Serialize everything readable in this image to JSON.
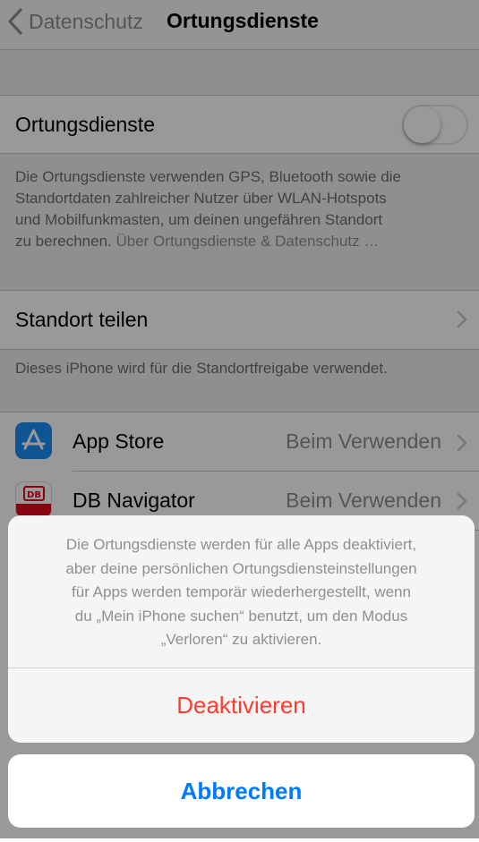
{
  "nav": {
    "back_label": "Datenschutz",
    "title": "Ortungsdienste"
  },
  "location_services": {
    "label": "Ortungsdienste",
    "enabled": false
  },
  "description": {
    "lines": [
      "Die Ortungsdienste verwenden GPS, Bluetooth sowie die",
      "Standortdaten zahlreicher Nutzer über WLAN-Hotspots",
      "und Mobilfunkmasten, um deinen ungefähren Standort",
      "zu berechnen."
    ],
    "link": "Über Ortungsdienste & Datenschutz …"
  },
  "share_location": {
    "label": "Standort teilen",
    "footer": "Dieses iPhone wird für die Standortfreigabe verwendet."
  },
  "apps": [
    {
      "name": "App Store",
      "value": "Beim Verwenden",
      "icon": "app-store-icon"
    },
    {
      "name": "DB Navigator",
      "value": "Beim Verwenden",
      "icon": "db-navigator-icon"
    }
  ],
  "action_sheet": {
    "message_lines": [
      "Die Ortungsdienste werden für alle Apps deaktiviert,",
      "aber deine persönlichen Ortungsdiensteinstellungen",
      "für Apps werden temporär wiederhergestellt, wenn",
      "du „Mein iPhone suchen“ benutzt, um den Modus",
      "„Verloren“ zu aktivieren."
    ],
    "destructive_label": "Deaktivieren",
    "cancel_label": "Abbrechen"
  },
  "colors": {
    "destructive": "#ff3b30",
    "tint": "#007aff",
    "app_store": "#1a8cf5",
    "db_red": "#e3061b"
  }
}
